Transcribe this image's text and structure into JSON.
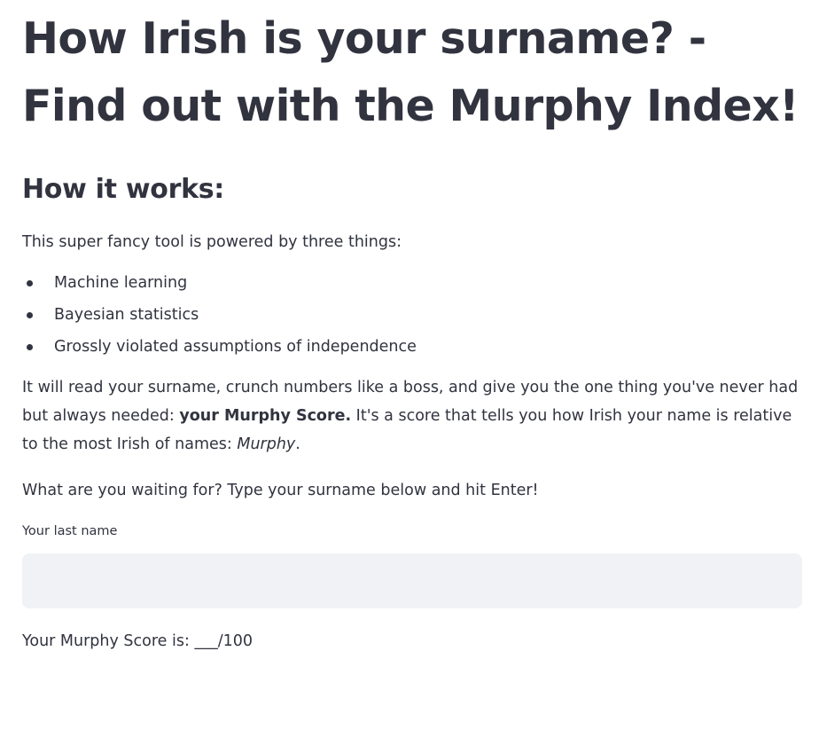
{
  "page": {
    "title": "How Irish is your surname? - Find out with the Murphy Index!",
    "subtitle": "How it works:",
    "intro": "This super fancy tool is powered by three things:",
    "bullets": [
      "Machine learning",
      "Bayesian statistics",
      "Grossly violated assumptions of independence"
    ],
    "description": {
      "part1": "It will read your surname, crunch numbers like a boss, and give you the one thing you've never had but always needed: ",
      "bold": "your Murphy Score.",
      "part2": " It's a score that tells you how Irish your name is relative to the most Irish of names: ",
      "italic": "Murphy",
      "part3": "."
    },
    "cta": "What are you waiting for? Type your surname below and hit Enter!",
    "input": {
      "label": "Your last name",
      "value": "",
      "placeholder": ""
    },
    "score_text": "Your Murphy Score is: ___/100"
  },
  "colors": {
    "text": "#31333f",
    "input_background": "#f0f2f6",
    "background": "#ffffff"
  }
}
